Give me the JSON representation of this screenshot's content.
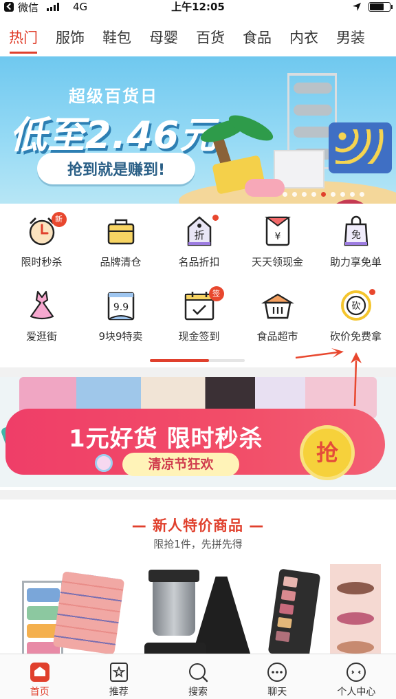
{
  "status_bar": {
    "carrier": "微信",
    "network": "4G",
    "time": "上午12:05"
  },
  "category_tabs": [
    {
      "label": "热门",
      "active": true
    },
    {
      "label": "服饰"
    },
    {
      "label": "鞋包"
    },
    {
      "label": "母婴"
    },
    {
      "label": "百货"
    },
    {
      "label": "食品"
    },
    {
      "label": "内衣"
    },
    {
      "label": "男装"
    }
  ],
  "banner1": {
    "subtitle": "超级百货日",
    "headline": "低至2.46元",
    "slogan": "抢到就是赚到!",
    "page_count": 9,
    "active_page": 4
  },
  "grid": {
    "items": [
      {
        "label": "限时秒杀",
        "icon": "alarm-clock-icon",
        "badge": "新"
      },
      {
        "label": "品牌清仓",
        "icon": "handbag-icon"
      },
      {
        "label": "名品折扣",
        "icon": "discount-tag-icon",
        "icon_text": "折",
        "red_dot": true
      },
      {
        "label": "天天领现金",
        "icon": "red-envelope-icon",
        "icon_text": "¥"
      },
      {
        "label": "助力享免单",
        "icon": "free-bag-icon",
        "icon_text": "免"
      },
      {
        "label": "爱逛街",
        "icon": "dress-icon"
      },
      {
        "label": "9块9特卖",
        "icon": "calendar-99-icon",
        "icon_text": "9.9"
      },
      {
        "label": "现金签到",
        "icon": "calendar-check-icon",
        "badge": "签"
      },
      {
        "label": "食品超市",
        "icon": "basket-icon"
      },
      {
        "label": "砍价免费拿",
        "icon": "bargain-icon",
        "icon_text": "砍",
        "red_dot": true
      }
    ],
    "page_progress": 0.62
  },
  "banner2": {
    "title": "1元好货 限时秒杀",
    "subtitle": "清凉节狂欢",
    "button": "抢"
  },
  "new_user": {
    "title": "— 新人特价商品 —",
    "subtitle": "限抢1件，先拼先得"
  },
  "tab_bar": [
    {
      "label": "首页",
      "icon": "home-icon",
      "active": true
    },
    {
      "label": "推荐",
      "icon": "recommend-icon"
    },
    {
      "label": "搜索",
      "icon": "search-icon"
    },
    {
      "label": "聊天",
      "icon": "chat-icon"
    },
    {
      "label": "个人中心",
      "icon": "profile-icon"
    }
  ],
  "colors": {
    "accent": "#e0402d",
    "banner_blue": "#6fc8ef",
    "promo_pink": "#ef3e68",
    "arrow_red": "#e8472e"
  }
}
